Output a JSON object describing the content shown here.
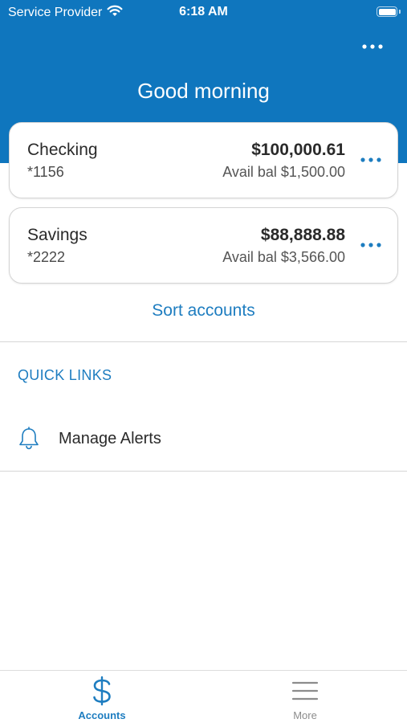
{
  "status_bar": {
    "carrier": "Service Provider",
    "time": "6:18 AM",
    "wifi_icon": "wifi-icon",
    "battery_icon": "battery-icon"
  },
  "header": {
    "greeting": "Good morning",
    "more_icon": "ellipsis-icon",
    "background_color": "#0f76be"
  },
  "accounts": [
    {
      "name": "Checking",
      "number": "*1156",
      "balance": "$100,000.61",
      "available": "Avail bal $1,500.00"
    },
    {
      "name": "Savings",
      "number": "*2222",
      "balance": "$88,888.88",
      "available": "Avail bal $3,566.00"
    }
  ],
  "sort_accounts_label": "Sort accounts",
  "quick_links": {
    "title": "QUICK LINKS",
    "items": [
      {
        "label": "Manage Alerts",
        "icon": "bell-icon"
      }
    ]
  },
  "tab_bar": {
    "tabs": [
      {
        "label": "Accounts",
        "icon": "dollar-icon",
        "active": true
      },
      {
        "label": "More",
        "icon": "hamburger-menu-icon",
        "active": false
      }
    ]
  },
  "colors": {
    "accent": "#1e7dc0",
    "header": "#0f76be",
    "text": "#2a2a2a",
    "inactive_tab": "#8c8c8c"
  }
}
